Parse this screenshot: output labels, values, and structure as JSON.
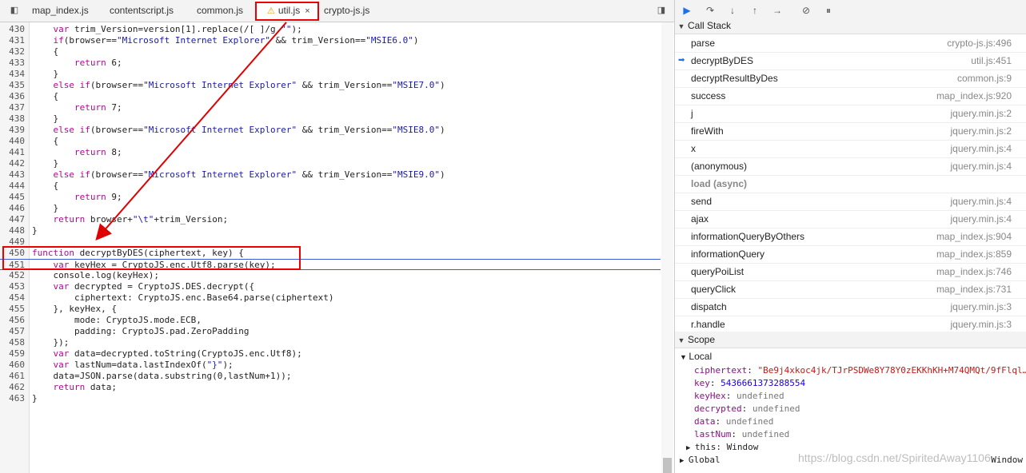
{
  "tabs": [
    {
      "label": "map_index.js",
      "active": false,
      "warning": false,
      "closable": false
    },
    {
      "label": "contentscript.js",
      "active": false,
      "warning": false,
      "closable": false
    },
    {
      "label": "common.js",
      "active": false,
      "warning": false,
      "closable": false
    },
    {
      "label": "util.js",
      "active": true,
      "warning": true,
      "closable": true
    },
    {
      "label": "crypto-js.js",
      "active": false,
      "warning": false,
      "closable": false
    }
  ],
  "code_lines": [
    {
      "n": "430",
      "text": "    var trim_Version=version[1].replace(/[ ]/g,\"\");"
    },
    {
      "n": "431",
      "text": "    if(browser==\"Microsoft Internet Explorer\" && trim_Version==\"MSIE6.0\")"
    },
    {
      "n": "432",
      "text": "    {"
    },
    {
      "n": "433",
      "text": "        return 6;"
    },
    {
      "n": "434",
      "text": "    }"
    },
    {
      "n": "435",
      "text": "    else if(browser==\"Microsoft Internet Explorer\" && trim_Version==\"MSIE7.0\")"
    },
    {
      "n": "436",
      "text": "    {"
    },
    {
      "n": "437",
      "text": "        return 7;"
    },
    {
      "n": "438",
      "text": "    }"
    },
    {
      "n": "439",
      "text": "    else if(browser==\"Microsoft Internet Explorer\" && trim_Version==\"MSIE8.0\")"
    },
    {
      "n": "440",
      "text": "    {"
    },
    {
      "n": "441",
      "text": "        return 8;"
    },
    {
      "n": "442",
      "text": "    }"
    },
    {
      "n": "443",
      "text": "    else if(browser==\"Microsoft Internet Explorer\" && trim_Version==\"MSIE9.0\")"
    },
    {
      "n": "444",
      "text": "    {"
    },
    {
      "n": "445",
      "text": "        return 9;"
    },
    {
      "n": "446",
      "text": "    }"
    },
    {
      "n": "447",
      "text": "    return browser+\"\\t\"+trim_Version;"
    },
    {
      "n": "448",
      "text": "}"
    },
    {
      "n": "449",
      "text": ""
    },
    {
      "n": "450",
      "text": "function decryptByDES(ciphertext, key) {"
    },
    {
      "n": "451",
      "text": "    var keyHex = CryptoJS.enc.Utf8.parse(key);"
    },
    {
      "n": "452",
      "text": "    console.log(keyHex);"
    },
    {
      "n": "453",
      "text": "    var decrypted = CryptoJS.DES.decrypt({"
    },
    {
      "n": "454",
      "text": "        ciphertext: CryptoJS.enc.Base64.parse(ciphertext)"
    },
    {
      "n": "455",
      "text": "    }, keyHex, {"
    },
    {
      "n": "456",
      "text": "        mode: CryptoJS.mode.ECB,"
    },
    {
      "n": "457",
      "text": "        padding: CryptoJS.pad.ZeroPadding"
    },
    {
      "n": "458",
      "text": "    });"
    },
    {
      "n": "459",
      "text": "    var data=decrypted.toString(CryptoJS.enc.Utf8);"
    },
    {
      "n": "460",
      "text": "    var lastNum=data.lastIndexOf(\"}\");"
    },
    {
      "n": "461",
      "text": "    data=JSON.parse(data.substring(0,lastNum+1));"
    },
    {
      "n": "462",
      "text": "    return data;"
    },
    {
      "n": "463",
      "text": "}"
    }
  ],
  "callstack": {
    "title": "Call Stack",
    "frames": [
      {
        "fn": "parse",
        "loc": "crypto-js.js:496",
        "current": false,
        "async": false
      },
      {
        "fn": "decryptByDES",
        "loc": "util.js:451",
        "current": true,
        "async": false
      },
      {
        "fn": "decryptResultByDes",
        "loc": "common.js:9",
        "current": false,
        "async": false
      },
      {
        "fn": "success",
        "loc": "map_index.js:920",
        "current": false,
        "async": false
      },
      {
        "fn": "j",
        "loc": "jquery.min.js:2",
        "current": false,
        "async": false
      },
      {
        "fn": "fireWith",
        "loc": "jquery.min.js:2",
        "current": false,
        "async": false
      },
      {
        "fn": "x",
        "loc": "jquery.min.js:4",
        "current": false,
        "async": false
      },
      {
        "fn": "(anonymous)",
        "loc": "jquery.min.js:4",
        "current": false,
        "async": false
      },
      {
        "fn": "load (async)",
        "loc": "",
        "current": false,
        "async": true
      },
      {
        "fn": "send",
        "loc": "jquery.min.js:4",
        "current": false,
        "async": false
      },
      {
        "fn": "ajax",
        "loc": "jquery.min.js:4",
        "current": false,
        "async": false
      },
      {
        "fn": "informationQueryByOthers",
        "loc": "map_index.js:904",
        "current": false,
        "async": false
      },
      {
        "fn": "informationQuery",
        "loc": "map_index.js:859",
        "current": false,
        "async": false
      },
      {
        "fn": "queryPoiList",
        "loc": "map_index.js:746",
        "current": false,
        "async": false
      },
      {
        "fn": "queryClick",
        "loc": "map_index.js:731",
        "current": false,
        "async": false
      },
      {
        "fn": "dispatch",
        "loc": "jquery.min.js:3",
        "current": false,
        "async": false
      },
      {
        "fn": "r.handle",
        "loc": "jquery.min.js:3",
        "current": false,
        "async": false
      }
    ]
  },
  "scope": {
    "title": "Scope",
    "local_title": "Local",
    "vars": [
      {
        "name": "ciphertext",
        "sep": ": ",
        "value": "\"Be9j4xkoc4jk/TJrPSDWe8Y78Y0zEKKhKH+M74QMQt/9fFlql…",
        "kind": "string"
      },
      {
        "name": "key",
        "sep": ": ",
        "value": "5436661373288554",
        "kind": "number"
      },
      {
        "name": "keyHex",
        "sep": ": ",
        "value": "undefined",
        "kind": "undef"
      },
      {
        "name": "decrypted",
        "sep": ": ",
        "value": "undefined",
        "kind": "undef"
      },
      {
        "name": "data",
        "sep": ": ",
        "value": "undefined",
        "kind": "undef"
      },
      {
        "name": "lastNum",
        "sep": ": ",
        "value": "undefined",
        "kind": "undef"
      }
    ],
    "this_label": "this: Window",
    "global_label": "Global",
    "global_value": "Window"
  },
  "watermark": "https://blog.csdn.net/SpiritedAway1106",
  "colors": {
    "highlight": "#e00000",
    "current_line": "#3b5bdb"
  }
}
